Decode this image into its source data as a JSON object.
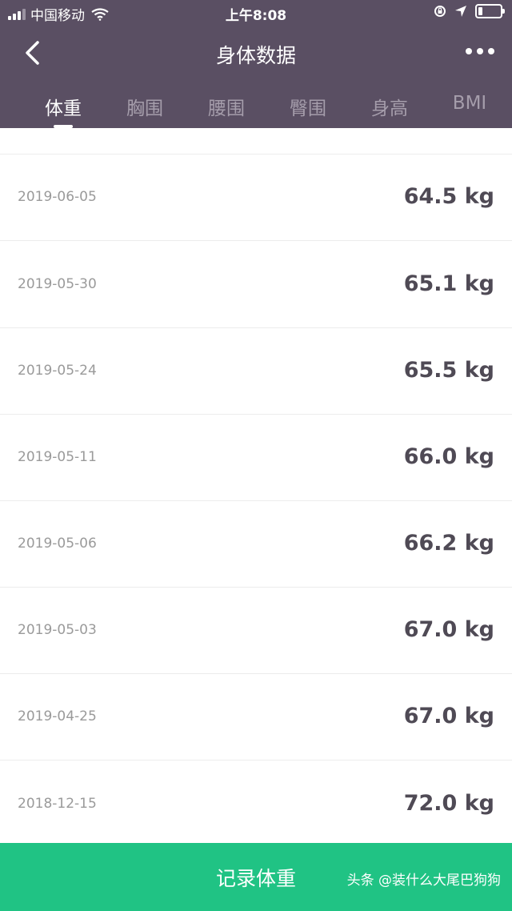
{
  "status_bar": {
    "carrier": "中国移动",
    "time": "上午8:08"
  },
  "nav": {
    "title": "身体数据"
  },
  "tabs": [
    {
      "label": "体重",
      "active": true
    },
    {
      "label": "胸围",
      "active": false
    },
    {
      "label": "腰围",
      "active": false
    },
    {
      "label": "臀围",
      "active": false
    },
    {
      "label": "身高",
      "active": false
    },
    {
      "label": "BMI",
      "active": false
    }
  ],
  "records": [
    {
      "date": "2019-06-05",
      "weight": "64.5 kg"
    },
    {
      "date": "2019-05-30",
      "weight": "65.1 kg"
    },
    {
      "date": "2019-05-24",
      "weight": "65.5 kg"
    },
    {
      "date": "2019-05-11",
      "weight": "66.0 kg"
    },
    {
      "date": "2019-05-06",
      "weight": "66.2 kg"
    },
    {
      "date": "2019-05-03",
      "weight": "67.0 kg"
    },
    {
      "date": "2019-04-25",
      "weight": "67.0 kg"
    },
    {
      "date": "2018-12-15",
      "weight": "72.0 kg"
    }
  ],
  "bottom": {
    "record_label": "记录体重",
    "watermark": "头条 @装什么大尾巴狗狗"
  },
  "colors": {
    "header_bg": "#5a4f63",
    "accent_green": "#20c384",
    "weight_text": "#4f4a55"
  }
}
